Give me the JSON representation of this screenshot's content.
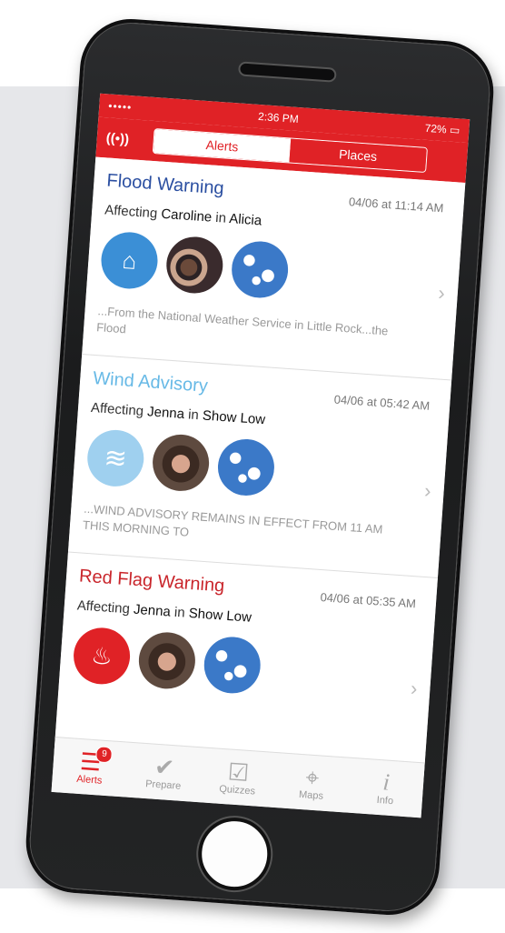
{
  "status": {
    "signal": "••••• ",
    "wifi": "wifi-icon",
    "time": "2:36 PM",
    "battery": "72%"
  },
  "nav": {
    "broadcast": "((•))",
    "tabs": [
      {
        "label": "Alerts"
      },
      {
        "label": "Places"
      }
    ]
  },
  "alerts": [
    {
      "title": "Flood Warning",
      "title_color": "#2b4fa1",
      "time": "04/06 at 11:14 AM",
      "affecting_prefix": "Affecting",
      "person": "Caroline",
      "in_label": "in",
      "place": "Alicia",
      "hazard_icon": "flood-icon",
      "hazard_glyph": "⌂",
      "desc": "...From the National Weather Service in Little Rock...the Flood"
    },
    {
      "title": "Wind Advisory",
      "title_color": "#67b9e6",
      "time": "04/06 at 05:42 AM",
      "affecting_prefix": "Affecting",
      "person": "Jenna",
      "in_label": "in",
      "place": "Show Low",
      "hazard_icon": "wind-icon",
      "hazard_glyph": "≋",
      "desc": "...WIND ADVISORY REMAINS IN EFFECT FROM 11 AM THIS MORNING TO"
    },
    {
      "title": "Red Flag Warning",
      "title_color": "#c9252b",
      "time": "04/06 at 05:35 AM",
      "affecting_prefix": "Affecting",
      "person": "Jenna",
      "in_label": "in",
      "place": "Show Low",
      "hazard_icon": "fire-icon",
      "hazard_glyph": "🔥",
      "desc": ""
    }
  ],
  "tabbar": [
    {
      "label": "Alerts",
      "icon": "alerts-icon",
      "glyph": "☰",
      "badge": "9"
    },
    {
      "label": "Prepare",
      "icon": "check-icon",
      "glyph": "✔"
    },
    {
      "label": "Quizzes",
      "icon": "quiz-icon",
      "glyph": "☑"
    },
    {
      "label": "Maps",
      "icon": "map-icon",
      "glyph": "⌖"
    },
    {
      "label": "Info",
      "icon": "info-icon",
      "glyph": "𝒊"
    }
  ]
}
